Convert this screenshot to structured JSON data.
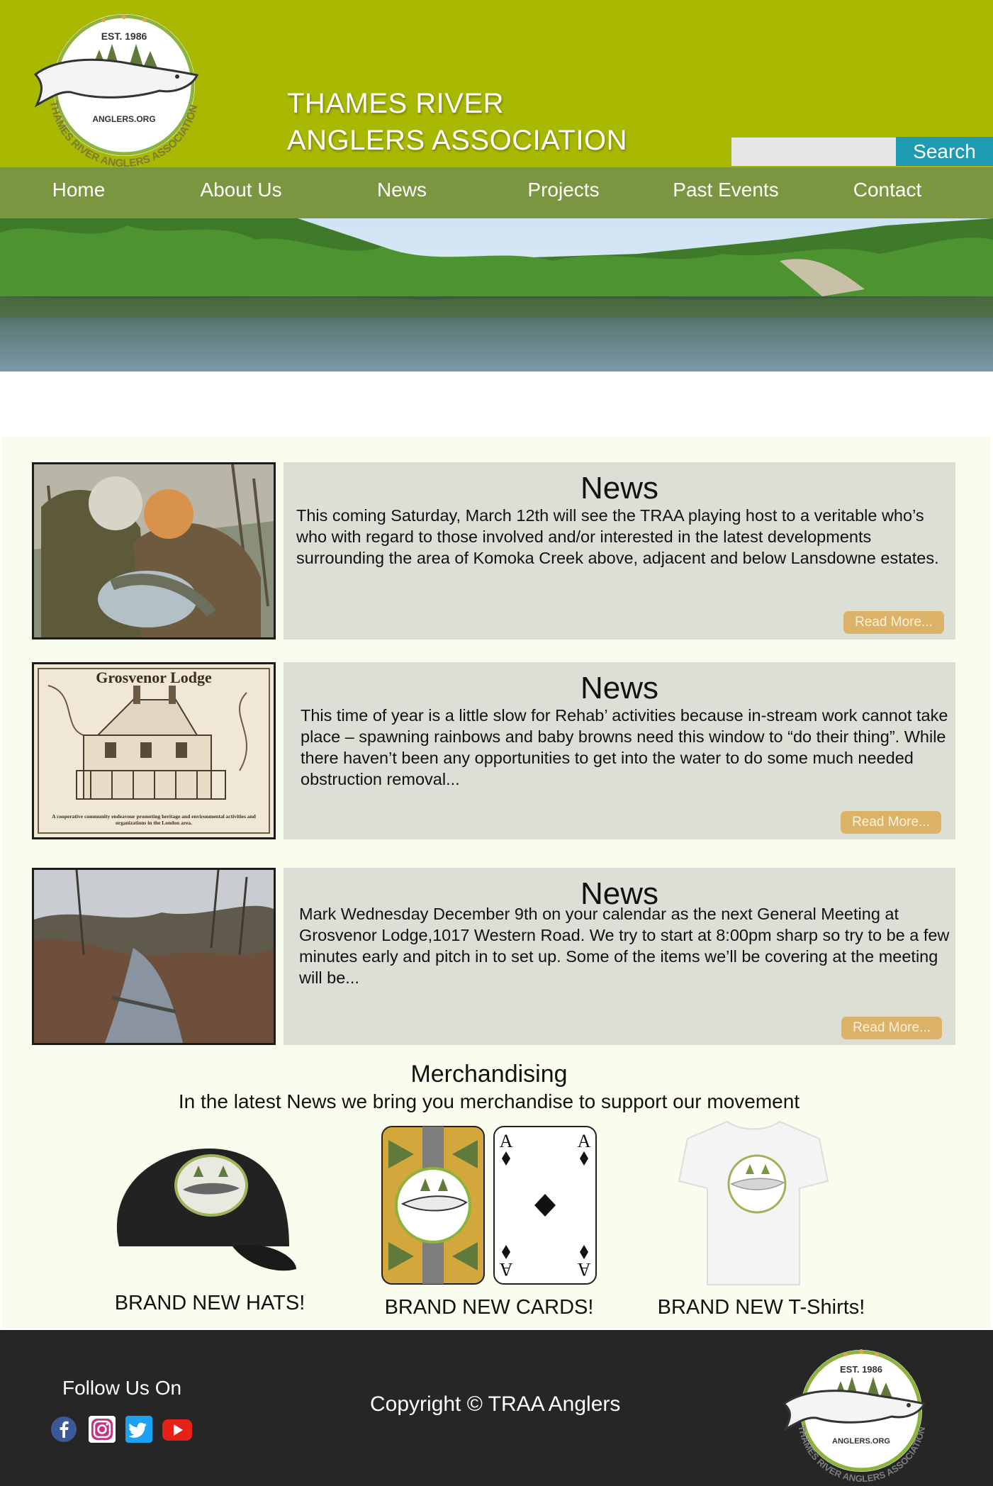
{
  "header": {
    "logo": {
      "est": "EST. 1986",
      "site": "ANGLERS.ORG",
      "ring_text": "THAMES RIVER ANGLERS ASSOCIATION"
    },
    "title_line1": "THAMES RIVER",
    "title_line2": "ANGLERS ASSOCIATION",
    "search": {
      "placeholder": "",
      "value": "",
      "button_label": "Search"
    }
  },
  "nav": {
    "items": [
      {
        "label": "Home"
      },
      {
        "label": "About Us"
      },
      {
        "label": "News"
      },
      {
        "label": "Projects"
      },
      {
        "label": "Past Events"
      },
      {
        "label": "Contact"
      }
    ]
  },
  "news": [
    {
      "title": "News",
      "text": "This coming Saturday, March 12th will see the TRAA playing host to a veritable who’s who with regard to those involved and/or interested in the latest developments surrounding the area of Komoka Creek above, adjacent and below Lansdowne estates.",
      "read_more": "Read More..."
    },
    {
      "title": "News",
      "text": "This time of year is a little slow for Rehab’ activities because in-stream work cannot take place – spawning rainbows and baby browns need this window to “do their thing”. While there haven’t been any opportunities to get into the water to do some much needed obstruction removal...",
      "read_more": "Read More...",
      "image_heading": "Grosvenor Lodge",
      "image_caption": "A cooperative community endeavour promoting heritage and environmental activities and organizations in the London area."
    },
    {
      "title": "News",
      "text": "Mark Wednesday December 9th on your calendar as the next General Meeting at Grosvenor Lodge,1017 Western Road. We try to start at 8:00pm sharp so try to be a few minutes early and pitch in to set up. Some of the items we’ll be covering at the meeting will be...",
      "read_more": "Read More..."
    }
  ],
  "merch": {
    "title": "Merchandising",
    "subtitle": "In the latest News we bring you merchandise to support our movement",
    "items": [
      {
        "caption": "BRAND NEW HATS!"
      },
      {
        "caption": "BRAND NEW CARDS!",
        "card_rank": "A"
      },
      {
        "caption": "BRAND NEW T-Shirts!"
      }
    ]
  },
  "footer": {
    "follow_label": "Follow Us On",
    "social": [
      "facebook-icon",
      "instagram-icon",
      "twitter-icon",
      "youtube-icon"
    ],
    "copyright": "Copyright © TRAA Anglers"
  },
  "colors": {
    "header_bg": "#a9b800",
    "nav_bg": "#7b9640",
    "search_button": "#1e9bb0",
    "content_bg": "#f9fded",
    "card_bg": "#dcdfd6",
    "read_more": "#dcb268",
    "footer_bg": "#262626"
  }
}
